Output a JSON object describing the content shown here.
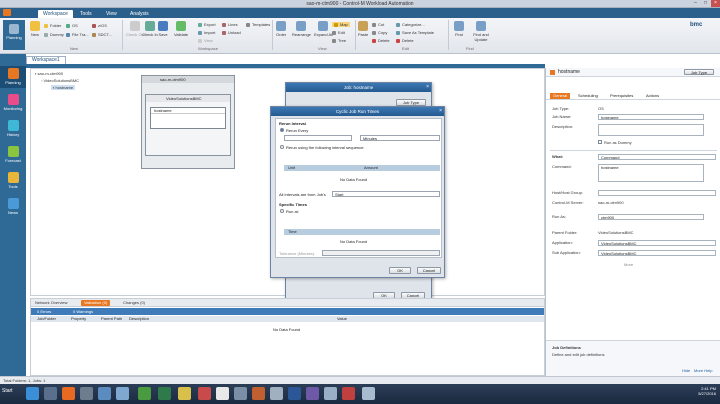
{
  "window": {
    "title": "sao-m-ctm900 - Control-M Workload Automation"
  },
  "ribbon_tabs": [
    "Workspace",
    "Tools",
    "View",
    "Analysis"
  ],
  "ribbon": {
    "buttons_left": [
      "New",
      "Open"
    ],
    "small_a": [
      "Folder",
      "Dummy"
    ],
    "small_b": [
      "OS",
      "File Tra..."
    ],
    "small_c": [
      "z/OS",
      "SDCT..."
    ],
    "check_in": "Check Out",
    "check_out": "Check In",
    "save": "Save",
    "validate": "Validate",
    "small_d": [
      "Export",
      "Import",
      "View"
    ],
    "small_e": [
      "Lines",
      "Unload"
    ],
    "small_f": [
      "Templates"
    ],
    "order": "Order",
    "rearrange": "Rearrange",
    "expand": "Expand All",
    "small_g": [
      "Map",
      "Edit",
      "Tree"
    ],
    "small_h": [
      "Paste"
    ],
    "small_i": [
      "Cut",
      "Copy",
      "Delete"
    ],
    "small_j": [
      "Categorize...",
      "Save As Template",
      "Delete"
    ],
    "find": "Find",
    "find_update": "Find and Update",
    "groups": [
      "New",
      "Workspace",
      "View",
      "Edit",
      "Find"
    ],
    "brand": "bmc"
  },
  "leftnav": [
    "Planning",
    "Monitoring",
    "History",
    "Forecast",
    "Tools",
    "News"
  ],
  "workspace_tab": "Workspace1",
  "tree": {
    "server": "sao-m-ctm900",
    "folder": "VideoSolutionsBMC",
    "job": "hostname"
  },
  "canvas": {
    "server_box": "sao-m-ctm900",
    "folder_box": "VideoSolutionsBMC",
    "job_box": "hostname"
  },
  "job_dialog": {
    "title": "Job: hostname",
    "type_btn": "Job Type",
    "ok": "OK",
    "cancel": "Cancel"
  },
  "cyclic_dialog": {
    "title": "Cyclic Job Run Times",
    "rerun_interval": "Rerun Interval",
    "rerun_every": "Rerun Every",
    "unit": "Minutes",
    "rerun_sequence": "Rerun using the following interval sequence:",
    "col_unit": "Unit",
    "col_amount": "Amount",
    "no_data": "No Data Found",
    "intervals_from": "All intervals are from Job's",
    "from_value": "Start",
    "specific_times": "Specific Times",
    "run_at": "Run at:",
    "col_time": "Time",
    "tolerance": "Tolerance (Minutes):",
    "ok": "OK",
    "cancel": "Cancel"
  },
  "bottom": {
    "tabs": [
      "Network Overview",
      "Validation (0)",
      "Changes (0)"
    ],
    "errors": "0 Errors",
    "warnings": "0 Warnings",
    "columns": [
      "Job/Folder",
      "Property",
      "Parent Path",
      "Description",
      "Value"
    ],
    "empty": "No Data Found"
  },
  "props": {
    "title": "hostname",
    "job_type_btn": "Job Type",
    "tabs": [
      "General",
      "Scheduling",
      "Prerequisites",
      "Actions"
    ],
    "job_type_label": "Job Type:",
    "job_type": "OS",
    "job_name_label": "Job Name:",
    "job_name": "hostname",
    "description_label": "Description:",
    "dummy_label": "Run as Dummy",
    "what_label": "What:",
    "what": "Command",
    "command_label": "Command:",
    "command": "hostname",
    "host_label": "Host/Host Group:",
    "server_label": "Control-M Server:",
    "server": "sao-m-ctm900",
    "runas_label": "Run As:",
    "runas": "ctm900",
    "parent_label": "Parent Folder:",
    "parent": "VideoSolutionsBMC",
    "app_label": "Application:",
    "app": "VideoSolutionsBMC",
    "subapp_label": "Sub Application:",
    "subapp": "VideoSolutionsBMC",
    "more": "More",
    "def_title": "Job Definitions",
    "def_text": "Define and edit job definitions",
    "help1": "Hide",
    "help2": "More Help"
  },
  "status": "Total Folders: 1, Jobs: 1",
  "taskbar": {
    "start": "Start",
    "time": "2:41 PM",
    "date": "5/27/2016"
  }
}
